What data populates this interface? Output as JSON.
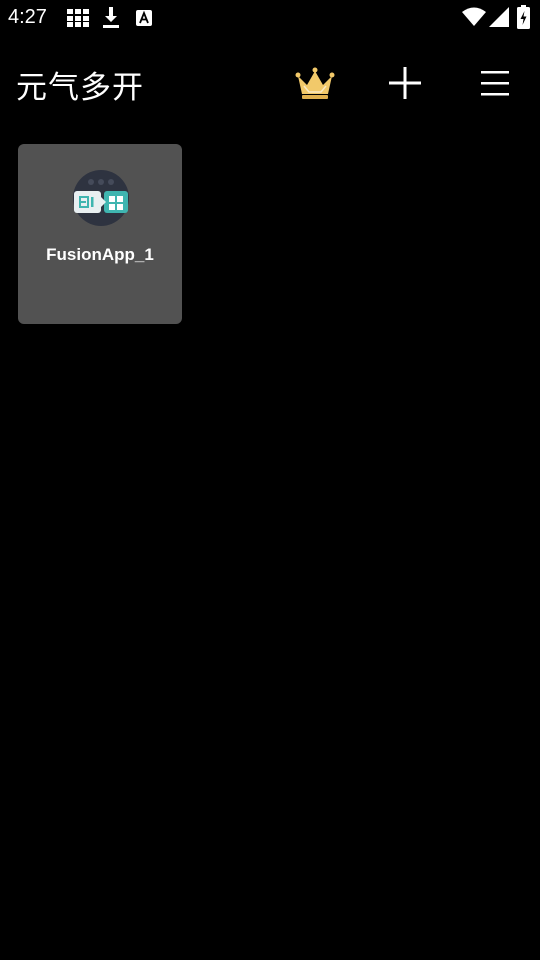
{
  "status_bar": {
    "time": "4:27",
    "left_icons": [
      "grid-icon",
      "download-icon",
      "a-icon"
    ],
    "right_icons": [
      "wifi-icon",
      "signal-icon",
      "battery-icon"
    ]
  },
  "app_bar": {
    "title": "元气多开",
    "actions": [
      "crown-icon",
      "plus-icon",
      "menu-icon"
    ]
  },
  "apps": [
    {
      "label": "FusionApp_1",
      "icon": "fusionapp-icon"
    }
  ],
  "colors": {
    "background": "#000000",
    "tile": "#525252",
    "crown": "#F2C96A",
    "icon_teal": "#3FB5B0"
  }
}
